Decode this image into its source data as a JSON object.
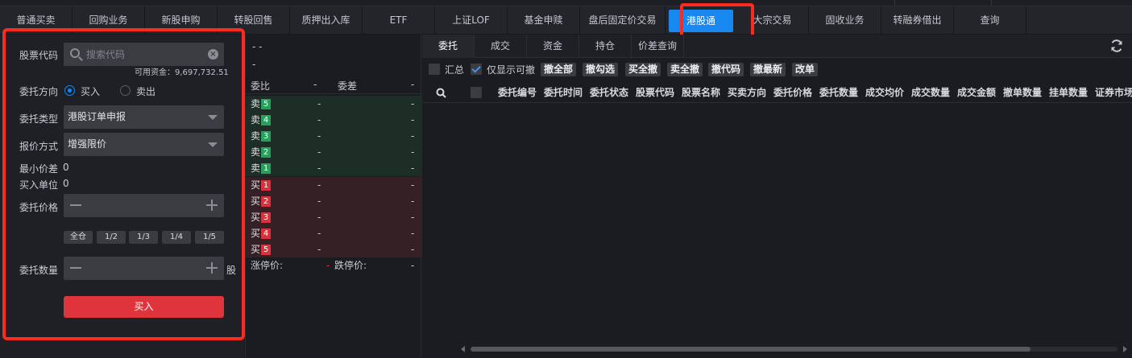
{
  "tabs": [
    {
      "label": "普通买卖"
    },
    {
      "label": "回购业务"
    },
    {
      "label": "新股申购"
    },
    {
      "label": "转股回售"
    },
    {
      "label": "质押出入库"
    },
    {
      "label": "ETF"
    },
    {
      "label": "上证LOF"
    },
    {
      "label": "基金申赎"
    },
    {
      "label": "盘后固定价交易"
    },
    {
      "label": "港股通"
    },
    {
      "label": "大宗交易"
    },
    {
      "label": "固收业务"
    },
    {
      "label": "转融券借出"
    },
    {
      "label": "查询"
    }
  ],
  "active_tab": "港股通",
  "form": {
    "stock_code_label": "股票代码",
    "search_placeholder": "搜索代码",
    "available_funds": "可用资金：9,697,732.51",
    "direction_label": "委托方向",
    "direction_buy": "买入",
    "direction_sell": "卖出",
    "order_type_label": "委托类型",
    "order_type_value": "港股订单申报",
    "price_mode_label": "报价方式",
    "price_mode_value": "增强限价",
    "min_tick_label": "最小价差",
    "min_tick_value": "0",
    "lot_label": "买入单位",
    "lot_value": "0",
    "price_label": "委托价格",
    "fractions": [
      "全仓",
      "1/2",
      "1/3",
      "1/4",
      "1/5"
    ],
    "qty_label": "委托数量",
    "qty_unit": "股",
    "submit_label": "买入"
  },
  "book": {
    "top_dash_1": "-  -",
    "top_dash_2": "-",
    "ratio_label": "委比",
    "ratio_value": "-",
    "diff_label": "委差",
    "diff_value": "-",
    "sell_rows": [
      {
        "side": "卖",
        "level": "5",
        "price": "-",
        "vol": "-"
      },
      {
        "side": "卖",
        "level": "4",
        "price": "-",
        "vol": "-"
      },
      {
        "side": "卖",
        "level": "3",
        "price": "-",
        "vol": "-"
      },
      {
        "side": "卖",
        "level": "2",
        "price": "-",
        "vol": "-"
      },
      {
        "side": "卖",
        "level": "1",
        "price": "-",
        "vol": "-"
      }
    ],
    "buy_rows": [
      {
        "side": "买",
        "level": "1",
        "price": "-",
        "vol": "-"
      },
      {
        "side": "买",
        "level": "2",
        "price": "-",
        "vol": "-"
      },
      {
        "side": "买",
        "level": "3",
        "price": "-",
        "vol": "-"
      },
      {
        "side": "买",
        "level": "4",
        "price": "-",
        "vol": "-"
      },
      {
        "side": "买",
        "level": "5",
        "price": "-",
        "vol": "-"
      }
    ],
    "limit_up_label": "涨停价:",
    "limit_up_value": "-",
    "limit_down_label": "跌停价:",
    "limit_down_value": "-"
  },
  "orders": {
    "subtabs": [
      "委托",
      "成交",
      "资金",
      "持仓",
      "价差查询"
    ],
    "active_subtab": "委托",
    "summary_label": "汇总",
    "only_cancelable_label": "仅显示可撤",
    "actions": [
      "撤全部",
      "撤勾选",
      "买全撤",
      "卖全撤",
      "撤代码",
      "撤最新",
      "改单"
    ],
    "columns": [
      "委托编号",
      "委托时间",
      "委托状态",
      "股票代码",
      "股票名称",
      "买卖方向",
      "委托价格",
      "委托数量",
      "成交均价",
      "成交数量",
      "成交金额",
      "撤单数量",
      "挂单数量",
      "证券市场"
    ]
  },
  "colors": {
    "accent": "#1788f0",
    "buy_button": "#e0343c",
    "highlight": "#ff2a1f",
    "sell_level": "#26a05a",
    "buy_level": "#d8333d"
  }
}
